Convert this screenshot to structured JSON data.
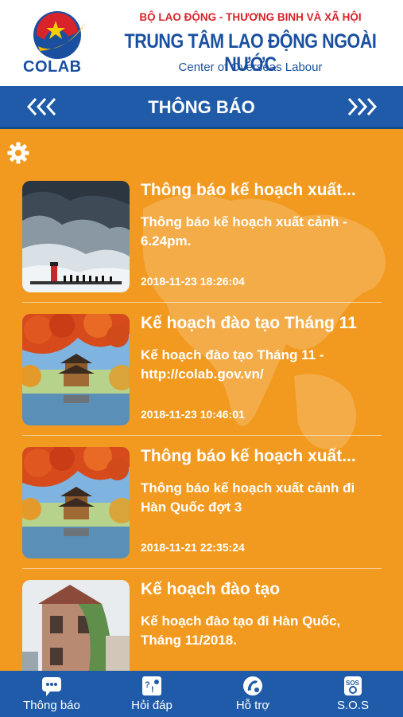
{
  "header": {
    "logo_text": "COLAB",
    "org_line1": "BỘ LAO ĐỘNG - THƯƠNG BINH VÀ XÃ HỘI",
    "org_line2": "TRUNG TÂM LAO ĐỘNG NGOÀI NƯỚC",
    "org_line3": "Center of Overseas Labour"
  },
  "titlebar": {
    "title": "THÔNG BÁO",
    "prev_label": "❮❮❮",
    "next_label": "❯❯❯"
  },
  "colors": {
    "background": "#f29a1f",
    "bar": "#1f5ba8",
    "brand_red": "#d8232a"
  },
  "items": [
    {
      "title": "Thông báo kế hoạch xuất...",
      "body": "Thông báo kế hoạch xuất cảnh - 6.24pm.",
      "time": "2018-11-23 18:26:04",
      "thumb": "storm-wave-image"
    },
    {
      "title": "Kế hoạch đào tạo Tháng 11",
      "body": "Kế hoạch đào tạo Tháng 11 - http://colab.gov.vn/",
      "time": "2018-11-23 10:46:01",
      "thumb": "autumn-pavilion-image"
    },
    {
      "title": "Thông báo kế hoạch xuất...",
      "body": "Thông báo kế hoạch xuất cảnh đi Hàn Quốc đợt 3",
      "time": "2018-11-21 22:35:24",
      "thumb": "autumn-pavilion-image"
    },
    {
      "title": "Kế hoạch đào tạo",
      "body": "Kế hoạch đào tạo đi Hàn Quốc, Tháng 11/2018.",
      "time": "",
      "thumb": "old-house-painting-image"
    }
  ],
  "tabs": [
    {
      "label": "Thông báo",
      "icon": "chat-icon"
    },
    {
      "label": "Hỏi đáp",
      "icon": "qa-icon"
    },
    {
      "label": "Hỗ trợ",
      "icon": "support-icon"
    },
    {
      "label": "S.O.S",
      "icon": "sos-icon",
      "icon_text": "SOS"
    }
  ]
}
